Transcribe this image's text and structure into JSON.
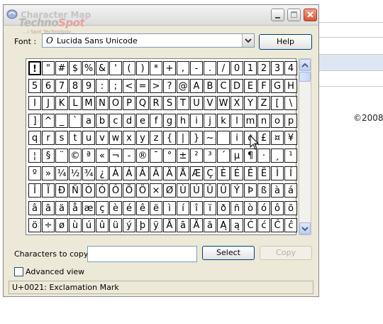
{
  "background": {
    "copyright": "©2008"
  },
  "window": {
    "title": "Character Map",
    "watermark_brand": "TechnoSpot",
    "watermark_tagline": "...i Spot Technology...",
    "buttons": [
      "minimize-icon",
      "maximize-icon",
      "close-icon"
    ]
  },
  "font": {
    "label": "Font :",
    "icon": "O",
    "value": "Lucida Sans Unicode",
    "help_label": "Help"
  },
  "grid": {
    "columns": 20,
    "selected": "!",
    "rows": [
      [
        "!",
        "\"",
        "#",
        "$",
        "%",
        "&",
        "'",
        "(",
        ")",
        "*",
        "+",
        ",",
        "-",
        ".",
        "/",
        "0",
        "1",
        "2",
        "3",
        "4"
      ],
      [
        "5",
        "6",
        "7",
        "8",
        "9",
        ":",
        ";",
        "<",
        "=",
        ">",
        "?",
        "@",
        "A",
        "B",
        "C",
        "D",
        "E",
        "F",
        "G",
        "H"
      ],
      [
        "I",
        "J",
        "K",
        "L",
        "M",
        "N",
        "O",
        "P",
        "Q",
        "R",
        "S",
        "T",
        "U",
        "V",
        "W",
        "X",
        "Y",
        "Z",
        "[",
        "\\"
      ],
      [
        "]",
        "^",
        "_",
        "`",
        "a",
        "b",
        "c",
        "d",
        "e",
        "f",
        "g",
        "h",
        "i",
        "j",
        "k",
        "l",
        "m",
        "n",
        "o",
        "p"
      ],
      [
        "q",
        "r",
        "s",
        "t",
        "u",
        "v",
        "w",
        "x",
        "y",
        "z",
        "{",
        "|",
        "}",
        "~",
        " ",
        "i",
        "¢",
        "£",
        "¤",
        "¥"
      ],
      [
        "¦",
        "§",
        "¨",
        "©",
        "ª",
        "«",
        "¬",
        "-",
        "®",
        "¯",
        "°",
        "±",
        "²",
        "³",
        "´",
        "µ",
        "¶",
        "·",
        "¸",
        "¹"
      ],
      [
        "º",
        "»",
        "¼",
        "½",
        "¾",
        "¿",
        "À",
        "Á",
        "Â",
        "Ã",
        "Ä",
        "Å",
        "Æ",
        "Ç",
        "È",
        "É",
        "Ê",
        "Ë",
        "Ì",
        "Í"
      ],
      [
        "Î",
        "Ï",
        "Ð",
        "Ñ",
        "Ò",
        "Ó",
        "Ô",
        "Õ",
        "Ö",
        "×",
        "Ø",
        "Ù",
        "Ú",
        "Û",
        "Ü",
        "Ý",
        "Þ",
        "ß",
        "à",
        "á"
      ],
      [
        "â",
        "ã",
        "ä",
        "å",
        "æ",
        "ç",
        "è",
        "é",
        "ê",
        "ë",
        "ì",
        "í",
        "î",
        "ï",
        "ð",
        "ñ",
        "ò",
        "ó",
        "ô",
        "õ"
      ],
      [
        "ö",
        "÷",
        "ø",
        "ù",
        "ú",
        "û",
        "ü",
        "ý",
        "þ",
        "ÿ",
        "Ā",
        "ā",
        "Ă",
        "ă",
        "Ą",
        "ą",
        "Ć",
        "ć",
        "Ĉ",
        "ĉ"
      ]
    ]
  },
  "copy": {
    "label": "Characters to copy :",
    "value": "",
    "select_label": "Select",
    "copy_label": "Copy"
  },
  "advanced": {
    "label": "Advanced view",
    "checked": false
  },
  "status": {
    "text": "U+0021: Exclamation Mark"
  }
}
